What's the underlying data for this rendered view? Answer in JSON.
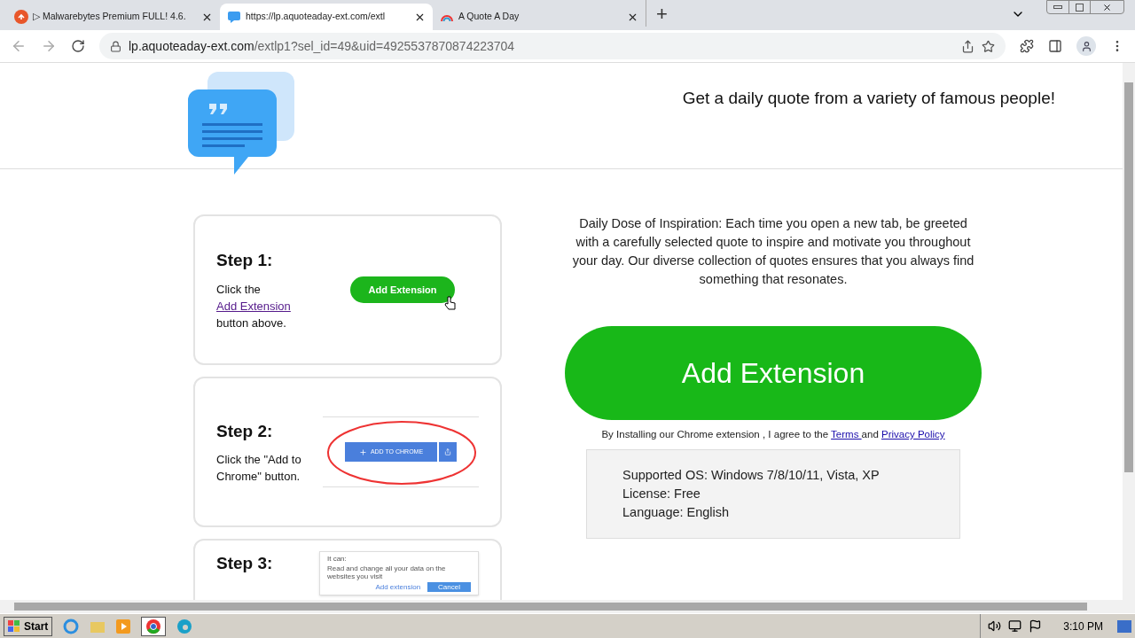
{
  "browser": {
    "tabs": [
      {
        "title": "▷ Malwarebytes Premium FULL! 4.6.",
        "selected": false
      },
      {
        "title": "https://lp.aquoteaday-ext.com/extl",
        "selected": true
      },
      {
        "title": "A Quote A Day",
        "selected": false
      }
    ],
    "new_tab": "+",
    "address": {
      "domain": "lp.aquoteaday-ext.com",
      "path": "/extlp1?sel_id=49&uid=4925537870874223704"
    }
  },
  "page": {
    "tagline": "Get a daily quote from a variety of famous people!",
    "steps": [
      {
        "title": "Step 1:",
        "before": "Click the ",
        "link": "Add Extension",
        "after": " button above.",
        "kind": "button",
        "illustration": [
          "Add Extension"
        ]
      },
      {
        "title": "Step 2:",
        "before": "Click the \"Add to Chrome\" button.",
        "kind": "store",
        "illustration": [
          "ADD TO CHROME"
        ]
      },
      {
        "title": "Step 3:",
        "kind": "dialog",
        "illustration": [
          "It can:",
          "Read and change all your data on the websites you visit",
          "Add extension",
          "Cancel"
        ]
      }
    ],
    "description": "Daily Dose of Inspiration: Each time you open a new tab, be greeted with a carefully selected quote to inspire and motivate you throughout your day. Our diverse collection of quotes ensures that you always find something that resonates.",
    "cta": "Add Extension",
    "consent": {
      "text": "By Installing our Chrome extension , I agree to the ",
      "terms": "Terms ",
      "and": "and ",
      "privacy": "Privacy Policy"
    },
    "info": [
      "Supported OS: Windows 7/8/10/11, Vista, XP",
      "License: Free",
      "Language: English"
    ]
  },
  "taskbar": {
    "start": "Start",
    "time": "3:10 PM"
  }
}
